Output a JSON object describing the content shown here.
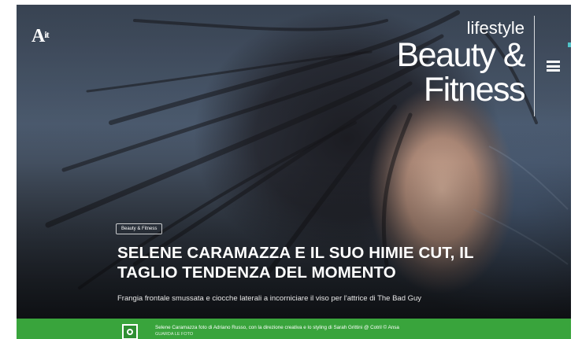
{
  "logo": {
    "main": "A",
    "suffix": "it"
  },
  "section": {
    "eyebrow": "lifestyle",
    "line1": "Beauty &",
    "line2": "Fitness"
  },
  "menu": {
    "icon": "hamburger-menu-icon"
  },
  "article": {
    "tag": "Beauty & Fitness",
    "title_line1": "SELENE CARAMAZZA E IL SUO HIMIE CUT, IL",
    "title_line2": "TAGLIO TENDENZA DEL MOMENTO",
    "subtitle": "Frangia frontale smussata e ciocche laterali a incorniciare il viso per l'attrice di The Bad Guy"
  },
  "photo_credit": {
    "text": "Selene Caramazza foto di Adriano Russo, con la direzione creativa e lo styling di Sarah Grittini @ Cotril © Ansa",
    "link": "GUARDA LE FOTO",
    "bar_color": "#39a43c",
    "icon": "camera-icon"
  }
}
